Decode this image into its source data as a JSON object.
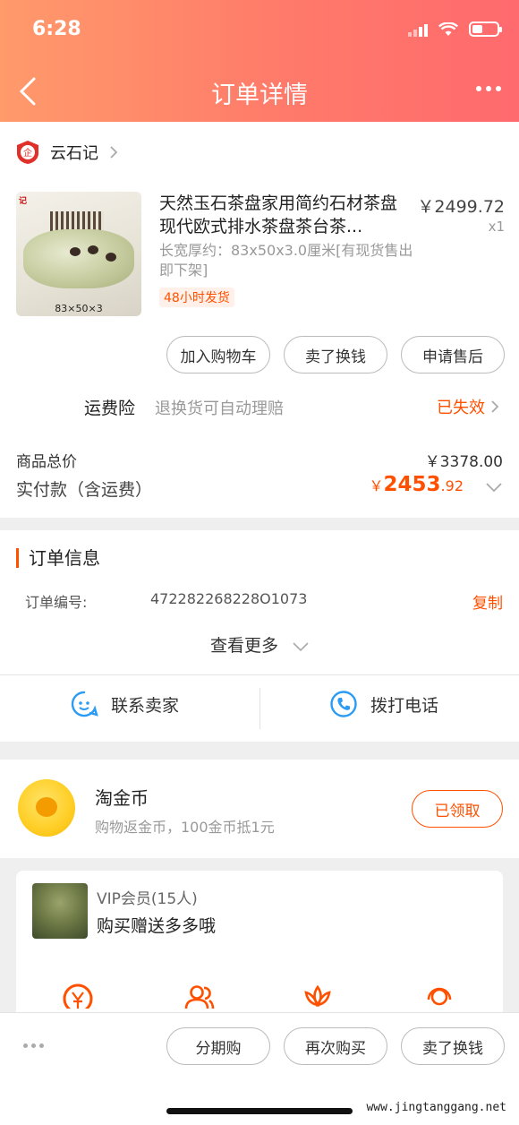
{
  "status_bar": {
    "time": "6:28"
  },
  "nav": {
    "title": "订单详情"
  },
  "shop": {
    "name": "云石记",
    "badge_text": "企"
  },
  "product": {
    "title": "天然玉石茶盘家用简约石材茶盘现代欧式排水茶盘茶台茶...",
    "price": "￥2499.72",
    "quantity": "x1",
    "spec": "长宽厚约：83x50x3.0厘米[有现货售出即下架]",
    "ship_tag": "48小时发货",
    "image_caption": "83×50×3"
  },
  "item_actions": {
    "add_cart": "加入购物车",
    "sell_exchange": "卖了换钱",
    "after_sale": "申请售后"
  },
  "insurance": {
    "label": "运费险",
    "desc": "退换货可自动理赔",
    "status": "已失效"
  },
  "summary": {
    "goods_total_label": "商品总价",
    "goods_total_value": "￥3378.00",
    "paid_label": "实付款（含运费）",
    "paid_currency": "￥",
    "paid_integer": "2453",
    "paid_decimal": ".92"
  },
  "order_info": {
    "section_title": "订单信息",
    "number_label": "订单编号:",
    "number_value": "472282268228O1073",
    "copy_label": "复制",
    "more_label": "查看更多"
  },
  "contact": {
    "seller": "联系卖家",
    "phone": "拨打电话"
  },
  "coins": {
    "title": "淘金币",
    "desc": "购物返金币，100金币抵1元",
    "button": "已领取"
  },
  "vip": {
    "title": "VIP会员(15人)",
    "desc": "购买赠送多多哦"
  },
  "bottom_actions": {
    "installment": "分期购",
    "buy_again": "再次购买",
    "sell_exchange": "卖了换钱"
  },
  "watermark": "www.jingtanggang.net",
  "colors": {
    "accent": "#ff5000",
    "header_start": "#ff9a6b",
    "header_end": "#ff6a6e"
  }
}
